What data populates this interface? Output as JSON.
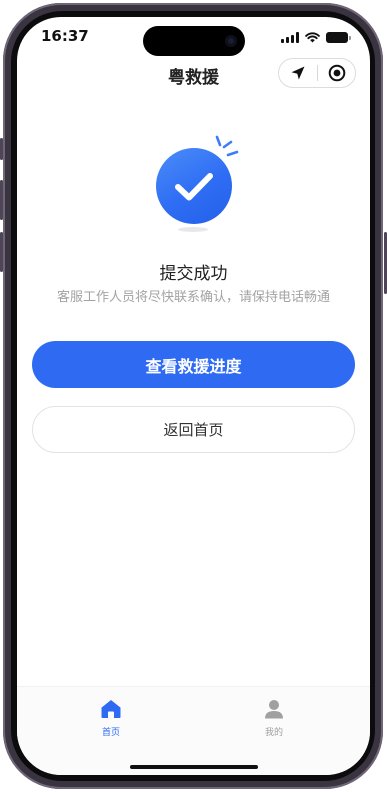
{
  "status_bar": {
    "time": "16:37"
  },
  "header": {
    "title": "粤救援"
  },
  "result": {
    "title": "提交成功",
    "message": "客服工作人员将尽快联系确认，请保持电话畅通"
  },
  "actions": {
    "primary_label": "查看救援进度",
    "secondary_label": "返回首页"
  },
  "tabbar": {
    "items": [
      {
        "label": "首页",
        "icon": "home-icon",
        "active": true
      },
      {
        "label": "我的",
        "icon": "user-icon",
        "active": false
      }
    ]
  },
  "colors": {
    "accent": "#2f6bf2",
    "tab_inactive": "#a0a0a0",
    "subtext": "#a3a3a3"
  }
}
